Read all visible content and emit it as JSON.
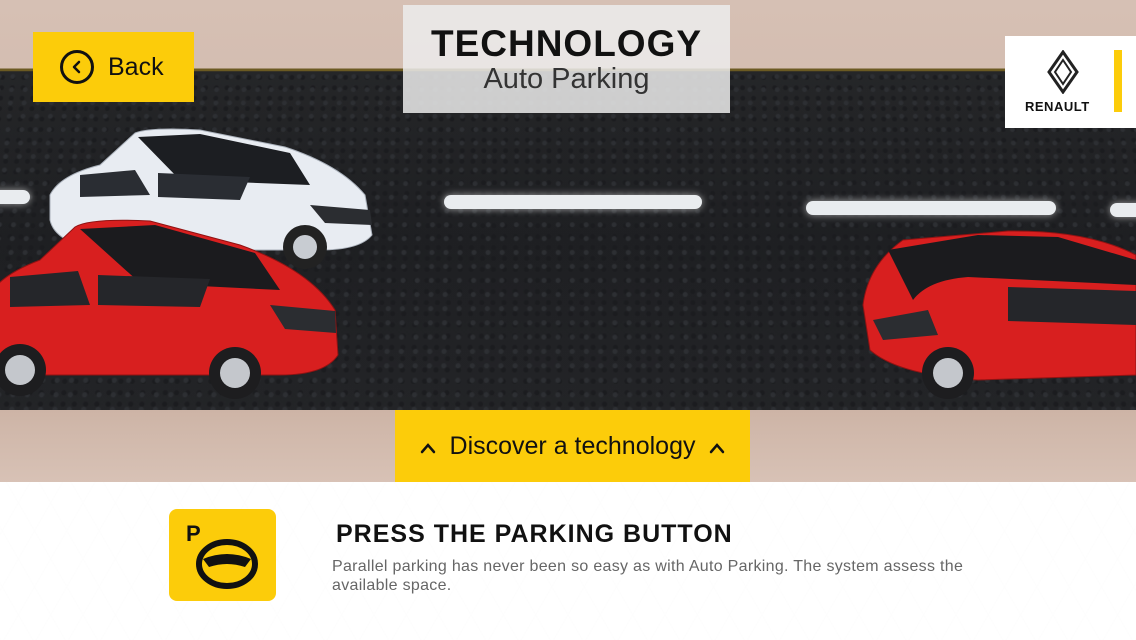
{
  "header": {
    "title": "TECHNOLOGY",
    "subtitle": "Auto Parking"
  },
  "back_button": {
    "label": "Back",
    "icon": "chevron-left-circle-icon"
  },
  "brand": {
    "name": "RENAULT",
    "icon": "renault-diamond-icon",
    "accent": "#fccc0a"
  },
  "discover": {
    "label": "Discover a technology",
    "icon": "chevron-up-icon"
  },
  "info_panel": {
    "icon_letter": "P",
    "icon": "steering-wheel-icon",
    "heading": "PRESS THE PARKING BUTTON",
    "body": "Parallel parking has never been so easy as with Auto Parking. The system assess the available space."
  },
  "colors": {
    "accent_yellow": "#fccc0a",
    "car_red": "#d81f1f",
    "car_white": "#e8ecf2"
  }
}
